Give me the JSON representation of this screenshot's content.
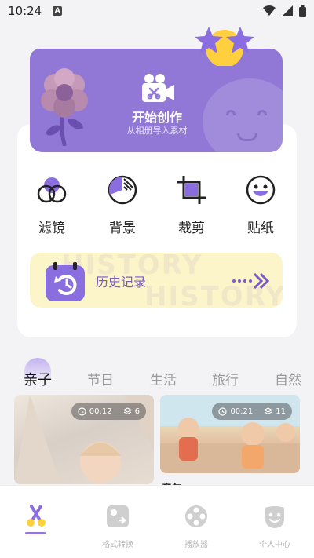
{
  "status_bar": {
    "time": "10:24",
    "notif_letter": "A"
  },
  "create": {
    "title": "开始创作",
    "subtitle": "从相册导入素材"
  },
  "tools": [
    {
      "label": "滤镜",
      "icon": "filter-icon"
    },
    {
      "label": "背景",
      "icon": "background-icon"
    },
    {
      "label": "裁剪",
      "icon": "crop-icon"
    },
    {
      "label": "贴纸",
      "icon": "sticker-icon"
    }
  ],
  "history": {
    "label": "历史记录",
    "bg_text": "HISTORY"
  },
  "categories": [
    "亲子",
    "节日",
    "生活",
    "旅行",
    "自然"
  ],
  "active_category": "亲子",
  "templates": [
    {
      "duration": "00:12",
      "layers": "6"
    },
    {
      "duration": "00:21",
      "layers": "11",
      "caption": "童年 ★"
    }
  ],
  "nav": [
    {
      "label": "",
      "icon": "scissors-icon"
    },
    {
      "label": "格式转换",
      "icon": "format-convert-icon"
    },
    {
      "label": "播放器",
      "icon": "film-reel-icon"
    },
    {
      "label": "个人中心",
      "icon": "profile-icon"
    }
  ],
  "colors": {
    "accent": "#9278d6",
    "history_bg": "#fcf5c9",
    "history_text": "#7a5cc8"
  }
}
